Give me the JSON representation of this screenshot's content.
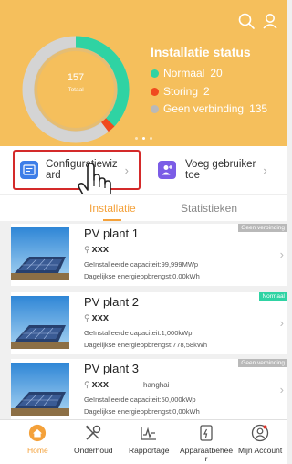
{
  "colors": {
    "header_bg": "#f5bf5c",
    "accent": "#f4a13a",
    "normal": "#2fd3a3",
    "fault": "#f04a1e",
    "offline": "#b9b9b9",
    "highlight_border": "#d42a2a"
  },
  "header": {
    "total_value": "157",
    "total_label": "Totaal",
    "status_title": "Installatie status",
    "legend": [
      {
        "label": "Normaal",
        "count": "20"
      },
      {
        "label": "Storing",
        "count": "2"
      },
      {
        "label": "Geen verbinding",
        "count": "135"
      }
    ],
    "icons": [
      "search-icon",
      "user-icon"
    ],
    "pager_active_index": 1
  },
  "actions": {
    "config_label_1": "Configuratiewiz",
    "config_label_2": "ard",
    "add_user_label_1": "Voeg gebruiker",
    "add_user_label_2": "toe"
  },
  "tabs": [
    {
      "label": "Installatie"
    },
    {
      "label": "Statistieken"
    }
  ],
  "plants": [
    {
      "name": "PV plant 1",
      "owner": "xxx",
      "extra": "",
      "capacity": "Geïnstalleerde capaciteit:99,999MWp",
      "energy": "Dagelijkse energieopbrengst:0,00kWh",
      "status": "Geen verbinding"
    },
    {
      "name": "PV plant 2",
      "owner": "xxx",
      "extra": "",
      "capacity": "Geïnstalleerde capaciteit:1,000kWp",
      "energy": "Dagelijkse energieopbrengst:778,58kWh",
      "status": "Normaal"
    },
    {
      "name": "PV plant 3",
      "owner": "xxx",
      "extra": "hanghai",
      "capacity": "Geïnstalleerde capaciteit:50,000kWp",
      "energy": "Dagelijkse energieopbrengst:0,00kWh",
      "status": "Geen verbinding"
    }
  ],
  "bottom_nav": [
    {
      "label": "Home",
      "icon": "home-icon"
    },
    {
      "label": "Onderhoud",
      "icon": "tools-icon"
    },
    {
      "label": "Rapportage",
      "icon": "chart-icon"
    },
    {
      "label": "Apparaatbeheer",
      "icon": "device-icon"
    },
    {
      "label": "Mijn Account",
      "icon": "account-icon"
    }
  ]
}
